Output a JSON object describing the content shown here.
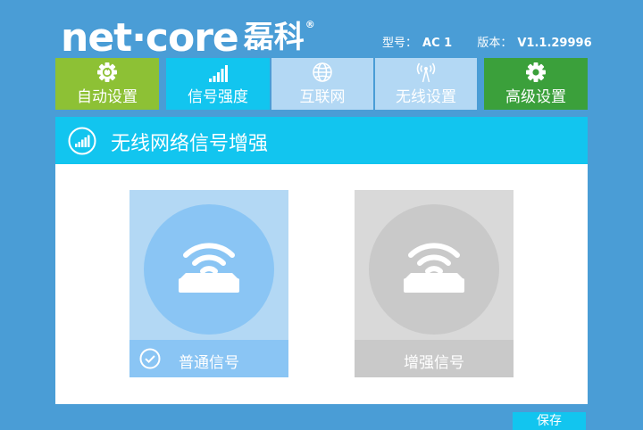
{
  "brand": {
    "logo_text": "net·core",
    "logo_cn": "磊科",
    "reg_mark": "®"
  },
  "device": {
    "model_label": "型号：",
    "model_value": "AC 1",
    "version_label": "版本：",
    "version_value": "V1.1.29996"
  },
  "nav": {
    "tabs": [
      {
        "label": "自动设置",
        "icon": "gear-refresh-icon"
      },
      {
        "label": "信号强度",
        "icon": "signal-bars-icon"
      },
      {
        "label": "互联网",
        "icon": "globe-icon"
      },
      {
        "label": "无线设置",
        "icon": "antenna-icon"
      },
      {
        "label": "高级设置",
        "icon": "gear-icon"
      }
    ],
    "active_index": 1
  },
  "panel": {
    "title": "无线网络信号增强",
    "options": [
      {
        "label": "普通信号",
        "selected": true
      },
      {
        "label": "增强信号",
        "selected": false
      }
    ],
    "save_label": "保存"
  },
  "colors": {
    "background": "#4a9dd6",
    "accent_cyan": "#12c5ef",
    "auto_green": "#8dc135",
    "advanced_green": "#3ba03b",
    "inactive_tab": "#b3d8f4",
    "selected_card": "#8ac5f4",
    "unselected_card": "#c9c9c9"
  }
}
